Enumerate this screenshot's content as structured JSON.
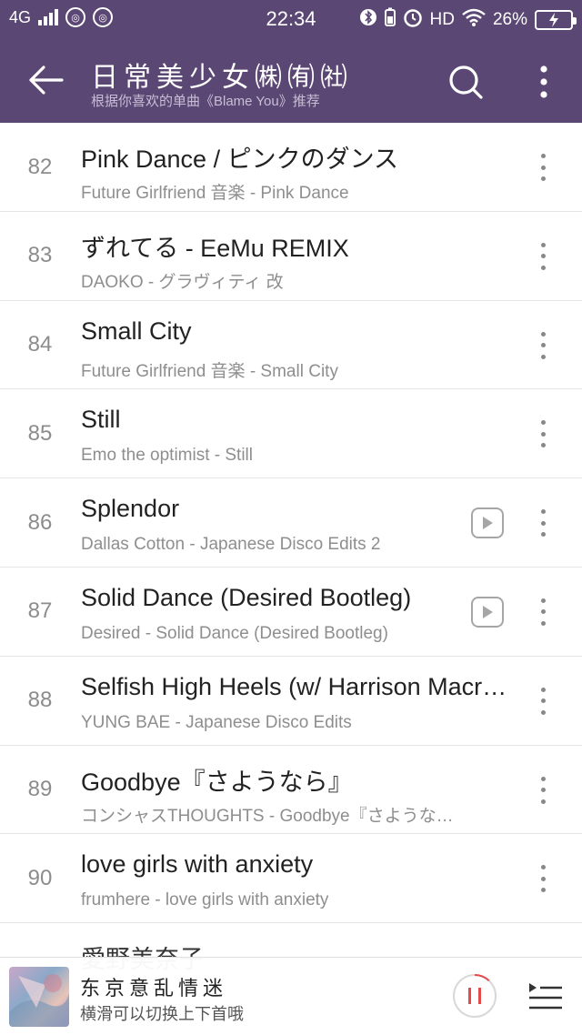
{
  "status_bar": {
    "network": "4G",
    "time": "22:34",
    "hd": "HD",
    "battery_percent": "26%"
  },
  "appbar": {
    "title": "日常美少女㈱㈲㈳",
    "subtitle": "根据你喜欢的单曲《Blame You》推荐",
    "back_icon": "back-arrow-icon",
    "search_icon": "search-icon",
    "more_icon": "more-vertical-icon"
  },
  "songs": [
    {
      "num": "82",
      "title": "Pink Dance / ピンクのダンス",
      "subtitle": "Future Girlfriend 音楽 - Pink Dance",
      "has_video": false
    },
    {
      "num": "83",
      "title": "ずれてる - EeMu REMIX",
      "subtitle": "DAOKO - グラヴィティ 改",
      "has_video": false
    },
    {
      "num": "84",
      "title": "Small City",
      "subtitle": "Future Girlfriend 音楽 - Small City",
      "has_video": false
    },
    {
      "num": "85",
      "title": "Still",
      "subtitle": "Emo the optimist - Still",
      "has_video": false
    },
    {
      "num": "86",
      "title": "Splendor",
      "subtitle": "Dallas Cotton - Japanese Disco Edits 2",
      "has_video": true
    },
    {
      "num": "87",
      "title": "Solid Dance (Desired Bootleg)",
      "subtitle": "Desired - Solid Dance (Desired Bootleg)",
      "has_video": true
    },
    {
      "num": "88",
      "title": "Selfish High Heels (w/ Harrison Macr…",
      "subtitle": "YUNG BAE - Japanese Disco Edits",
      "has_video": false
    },
    {
      "num": "89",
      "title": "Goodbye『さようなら』",
      "subtitle": "コンシャスTHOUGHTS - Goodbye『さようなら』",
      "has_video": false
    },
    {
      "num": "90",
      "title": "love girls with anxiety",
      "subtitle": "frumhere - love girls with anxiety",
      "has_video": false
    }
  ],
  "partial_song": {
    "title": "愛野美奈子"
  },
  "player": {
    "title": "东京意乱情迷",
    "subtitle": "横滑可以切换上下首哦",
    "progress": 0.12,
    "accent_color": "#e24b4b"
  },
  "colors": {
    "header_bg": "#5a4773"
  }
}
